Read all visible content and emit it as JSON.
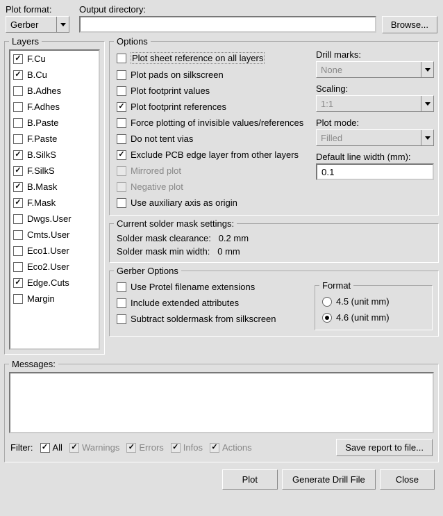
{
  "plot_format": {
    "label": "Plot format:",
    "value": "Gerber"
  },
  "output_dir": {
    "label": "Output directory:",
    "value": "",
    "browse": "Browse..."
  },
  "layers": {
    "legend": "Layers",
    "items": [
      {
        "name": "F.Cu",
        "checked": true
      },
      {
        "name": "B.Cu",
        "checked": true
      },
      {
        "name": "B.Adhes",
        "checked": false
      },
      {
        "name": "F.Adhes",
        "checked": false
      },
      {
        "name": "B.Paste",
        "checked": false
      },
      {
        "name": "F.Paste",
        "checked": false
      },
      {
        "name": "B.SilkS",
        "checked": true
      },
      {
        "name": "F.SilkS",
        "checked": true
      },
      {
        "name": "B.Mask",
        "checked": true
      },
      {
        "name": "F.Mask",
        "checked": true
      },
      {
        "name": "Dwgs.User",
        "checked": false
      },
      {
        "name": "Cmts.User",
        "checked": false
      },
      {
        "name": "Eco1.User",
        "checked": false
      },
      {
        "name": "Eco2.User",
        "checked": false
      },
      {
        "name": "Edge.Cuts",
        "checked": true
      },
      {
        "name": "Margin",
        "checked": false
      }
    ]
  },
  "options": {
    "legend": "Options",
    "left_checks": [
      {
        "label": "Plot sheet reference on all layers",
        "checked": false,
        "enabled": true,
        "highlight": true
      },
      {
        "label": "Plot pads on silkscreen",
        "checked": false,
        "enabled": true
      },
      {
        "label": "Plot footprint values",
        "checked": false,
        "enabled": true
      },
      {
        "label": "Plot footprint references",
        "checked": true,
        "enabled": true
      },
      {
        "label": "Force plotting of invisible values/references",
        "checked": false,
        "enabled": true
      },
      {
        "label": "Do not tent vias",
        "checked": false,
        "enabled": true
      },
      {
        "label": "Exclude PCB edge layer from other layers",
        "checked": true,
        "enabled": true
      },
      {
        "label": "Mirrored plot",
        "checked": false,
        "enabled": false
      },
      {
        "label": "Negative plot",
        "checked": false,
        "enabled": false
      },
      {
        "label": "Use auxiliary axis as origin",
        "checked": false,
        "enabled": true
      }
    ],
    "right": {
      "drill_marks": {
        "label": "Drill marks:",
        "value": "None",
        "enabled": false
      },
      "scaling": {
        "label": "Scaling:",
        "value": "1:1",
        "enabled": false
      },
      "plot_mode": {
        "label": "Plot mode:",
        "value": "Filled",
        "enabled": false
      },
      "line_width": {
        "label": "Default line width (mm):",
        "value": "0.1"
      }
    }
  },
  "solder": {
    "legend": "Current solder mask settings:",
    "clearance_label": "Solder mask clearance:",
    "clearance_value": "0.2 mm",
    "minwidth_label": "Solder mask min width:",
    "minwidth_value": "0 mm"
  },
  "gerber": {
    "legend": "Gerber Options",
    "checks": [
      {
        "label": "Use Protel filename extensions",
        "checked": false
      },
      {
        "label": "Include extended attributes",
        "checked": false
      },
      {
        "label": "Subtract soldermask from silkscreen",
        "checked": false
      }
    ],
    "format": {
      "legend": "Format",
      "opts": [
        {
          "label": "4.5 (unit mm)",
          "checked": false
        },
        {
          "label": "4.6 (unit mm)",
          "checked": true
        }
      ]
    }
  },
  "messages": {
    "legend": "Messages:",
    "filter_label": "Filter:",
    "filters": [
      {
        "label": "All",
        "checked": true,
        "enabled": true
      },
      {
        "label": "Warnings",
        "checked": true,
        "enabled": false
      },
      {
        "label": "Errors",
        "checked": true,
        "enabled": false
      },
      {
        "label": "Infos",
        "checked": true,
        "enabled": false
      },
      {
        "label": "Actions",
        "checked": true,
        "enabled": false
      }
    ],
    "save_btn": "Save report to file..."
  },
  "footer": {
    "plot": "Plot",
    "drill": "Generate Drill File",
    "close": "Close"
  }
}
